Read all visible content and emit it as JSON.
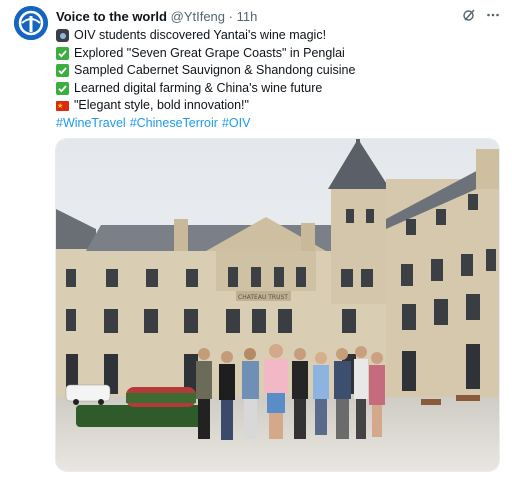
{
  "tweet": {
    "author_name": "Voice to the world",
    "author_handle": "@YtIfeng",
    "separator": "·",
    "time": "11h",
    "lines": [
      {
        "emoji": "camera",
        "text": "OIV students discovered Yantai's wine magic!"
      },
      {
        "emoji": "check",
        "text": "Explored \"Seven Great Grape Coasts\" in Penglai"
      },
      {
        "emoji": "check",
        "text": "Sampled Cabernet Sauvignon & Shandong cuisine"
      },
      {
        "emoji": "check",
        "text": "Learned digital farming & China's wine future"
      },
      {
        "emoji": "china-flag",
        "text": "\"Elegant style, bold innovation!\""
      }
    ],
    "hashtags": [
      "#WineTravel",
      "#ChineseTerroir",
      "#OIV"
    ],
    "photo": {
      "sign_text": "CHATEAU TRUST"
    }
  },
  "colors": {
    "link": "#1d9bf0",
    "secondary_text": "#536471",
    "avatar_bg": "#1565c0",
    "check_green": "#3cae3f"
  },
  "icons": [
    "avatar-logo",
    "grok-icon",
    "more-icon",
    "camera-emoji",
    "check-emoji",
    "china-flag-emoji"
  ]
}
